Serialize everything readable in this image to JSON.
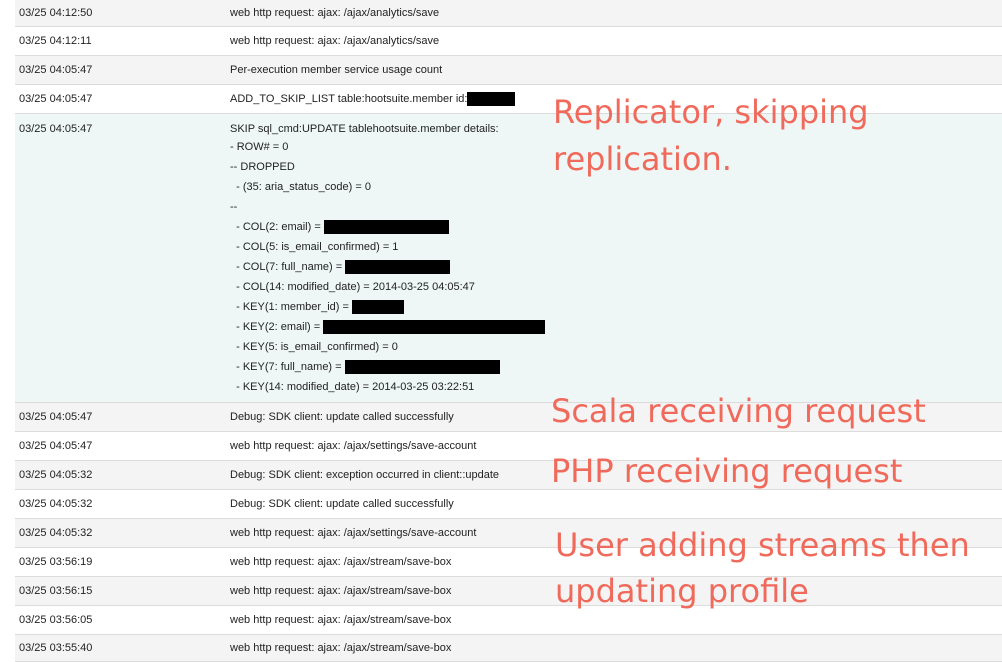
{
  "colors": {
    "row_odd": "#f4f4f4",
    "row_even": "#ffffff",
    "row_highlight": "#eef6f6",
    "annotation": "#f06a5c",
    "redaction": "#000000"
  },
  "rows_before": [
    {
      "ts": "03/25 04:12:50",
      "msg": "web http request: ajax: /ajax/analytics/save"
    },
    {
      "ts": "03/25 04:12:11",
      "msg": "web http request: ajax: /ajax/analytics/save"
    },
    {
      "ts": "03/25 04:05:47",
      "msg": "Per-execution member service usage count"
    },
    {
      "ts": "03/25 04:05:47",
      "msg": "ADD_TO_SKIP_LIST table:hootsuite.member id:"
    }
  ],
  "detail_row": {
    "ts": "03/25 04:05:47",
    "lines": [
      "SKIP sql_cmd:UPDATE tablehootsuite.member details:",
      "- ROW# = 0",
      "-- DROPPED",
      "  - (35: aria_status_code) = 0",
      "--",
      "  - COL(2: email) =",
      "  - COL(5: is_email_confirmed) = 1",
      "  - COL(7: full_name) =",
      "  - COL(14: modified_date) = 2014-03-25 04:05:47",
      "  - KEY(1: member_id) =",
      "  - KEY(2: email) =",
      "  - KEY(5: is_email_confirmed) = 0",
      "  - KEY(7: full_name) =",
      "  - KEY(14: modified_date) = 2014-03-25 03:22:51"
    ]
  },
  "rows_after": [
    {
      "ts": "03/25 04:05:47",
      "msg": "Debug: SDK client: update called successfully"
    },
    {
      "ts": "03/25 04:05:47",
      "msg": "web http request: ajax: /ajax/settings/save-account"
    },
    {
      "ts": "03/25 04:05:32",
      "msg": "Debug: SDK client: exception occurred in client::update"
    },
    {
      "ts": "03/25 04:05:32",
      "msg": "Debug: SDK client: update called successfully"
    },
    {
      "ts": "03/25 04:05:32",
      "msg": "web http request: ajax: /ajax/settings/save-account"
    },
    {
      "ts": "03/25 03:56:19",
      "msg": "web http request: ajax: /ajax/stream/save-box"
    },
    {
      "ts": "03/25 03:56:15",
      "msg": "web http request: ajax: /ajax/stream/save-box"
    },
    {
      "ts": "03/25 03:56:05",
      "msg": "web http request: ajax: /ajax/stream/save-box"
    },
    {
      "ts": "03/25 03:55:40",
      "msg": "web http request: ajax: /ajax/stream/save-box"
    }
  ],
  "annotations": {
    "replicator_1": "Replicator, skipping",
    "replicator_2": "replication.",
    "scala": "Scala receiving request",
    "php": "PHP receiving request",
    "user_1": "User adding streams then",
    "user_2": "updating profile"
  }
}
